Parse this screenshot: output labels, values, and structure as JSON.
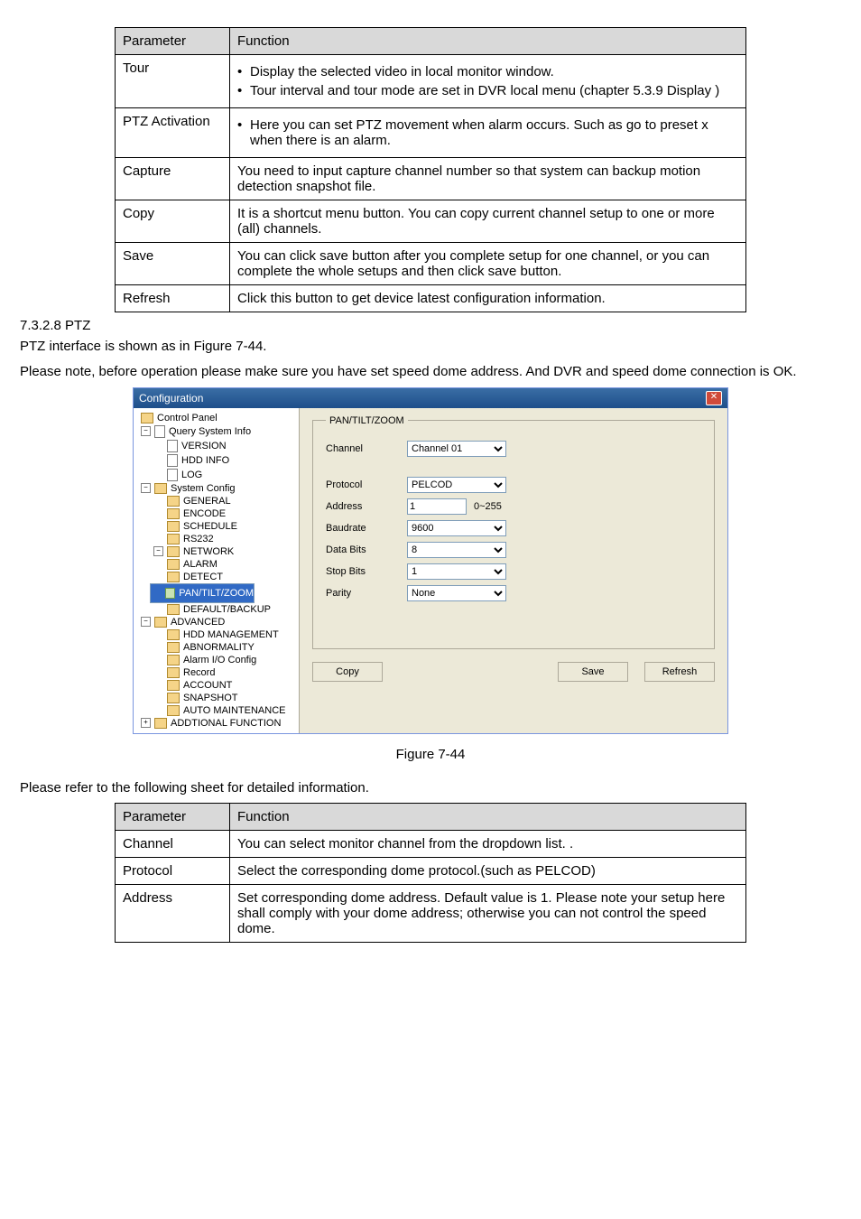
{
  "table1": {
    "headers": [
      "Parameter",
      "Function"
    ],
    "rows": [
      {
        "param": "Tour",
        "bullets": [
          "Display the selected video in local monitor window.",
          "Tour interval and tour mode are set in DVR local menu (chapter 5.3.9 Display )"
        ]
      },
      {
        "param": "PTZ Activation",
        "text": "Here you can set PTZ movement when alarm occurs. Such as go to preset x when there is an alarm.",
        "bullet": true
      },
      {
        "param": "Capture",
        "text": "You need to input capture channel number so that system can backup motion detection snapshot file."
      },
      {
        "param": "Copy",
        "text": "It is a shortcut menu button. You can copy current channel setup to one or more (all) channels."
      },
      {
        "param": "Save",
        "text": "You can click save button after you complete setup for one channel, or you can complete the whole setups and then click save button."
      },
      {
        "param": "Refresh",
        "text": "Click this button to get device latest configuration information."
      }
    ]
  },
  "section_num": "7.3.2.8  PTZ",
  "para1": "PTZ interface is shown as in Figure 7-44.",
  "para2": "Please note, before operation please make sure you have set speed dome address. And DVR and speed dome connection is OK.",
  "dialog": {
    "title": "Configuration",
    "legend": "PAN/TILT/ZOOM",
    "tree": [
      {
        "lvl": 1,
        "exp": "",
        "icon": "panel",
        "label": "Control Panel"
      },
      {
        "lvl": 1,
        "exp": "-",
        "icon": "doc",
        "label": "Query System Info"
      },
      {
        "lvl": 2,
        "exp": "",
        "icon": "doc",
        "label": "VERSION"
      },
      {
        "lvl": 2,
        "exp": "",
        "icon": "doc",
        "label": "HDD INFO"
      },
      {
        "lvl": 2,
        "exp": "",
        "icon": "doc",
        "label": "LOG"
      },
      {
        "lvl": 1,
        "exp": "-",
        "icon": "fld",
        "label": "System Config"
      },
      {
        "lvl": 2,
        "exp": "",
        "icon": "fld",
        "label": "GENERAL"
      },
      {
        "lvl": 2,
        "exp": "",
        "icon": "fld",
        "label": "ENCODE"
      },
      {
        "lvl": 2,
        "exp": "",
        "icon": "fld",
        "label": "SCHEDULE"
      },
      {
        "lvl": 2,
        "exp": "",
        "icon": "fld",
        "label": "RS232"
      },
      {
        "lvl": 2,
        "exp": "-",
        "icon": "fld",
        "label": "NETWORK"
      },
      {
        "lvl": 2,
        "exp": "",
        "icon": "fld",
        "label": "ALARM"
      },
      {
        "lvl": 2,
        "exp": "",
        "icon": "fld",
        "label": "DETECT"
      },
      {
        "lvl": 2,
        "exp": "",
        "icon": "open",
        "label": "PAN/TILT/ZOOM",
        "sel": true
      },
      {
        "lvl": 2,
        "exp": "",
        "icon": "fld",
        "label": "DEFAULT/BACKUP"
      },
      {
        "lvl": 1,
        "exp": "-",
        "icon": "adv",
        "label": "ADVANCED"
      },
      {
        "lvl": 2,
        "exp": "",
        "icon": "fld",
        "label": "HDD MANAGEMENT"
      },
      {
        "lvl": 2,
        "exp": "",
        "icon": "fld",
        "label": "ABNORMALITY"
      },
      {
        "lvl": 2,
        "exp": "",
        "icon": "fld",
        "label": "Alarm I/O Config"
      },
      {
        "lvl": 2,
        "exp": "",
        "icon": "fld",
        "label": "Record"
      },
      {
        "lvl": 2,
        "exp": "",
        "icon": "fld",
        "label": "ACCOUNT"
      },
      {
        "lvl": 2,
        "exp": "",
        "icon": "fld",
        "label": "SNAPSHOT"
      },
      {
        "lvl": 2,
        "exp": "",
        "icon": "fld",
        "label": "AUTO MAINTENANCE"
      },
      {
        "lvl": 1,
        "exp": "+",
        "icon": "fld",
        "label": "ADDTIONAL FUNCTION"
      }
    ],
    "fields": {
      "channel_lbl": "Channel",
      "channel_val": "Channel 01",
      "protocol_lbl": "Protocol",
      "protocol_val": "PELCOD",
      "address_lbl": "Address",
      "address_val": "1",
      "address_hint": "0~255",
      "baudrate_lbl": "Baudrate",
      "baudrate_val": "9600",
      "databits_lbl": "Data Bits",
      "databits_val": "8",
      "stopbits_lbl": "Stop Bits",
      "stopbits_val": "1",
      "parity_lbl": "Parity",
      "parity_val": "None"
    },
    "buttons": {
      "copy": "Copy",
      "save": "Save",
      "refresh": "Refresh"
    }
  },
  "figure_caption": "Figure 7-44",
  "para3": "Please refer to the following sheet for detailed information.",
  "table2": {
    "headers": [
      "Parameter",
      "Function"
    ],
    "rows": [
      {
        "param": "Channel",
        "text": "You can select monitor channel from the dropdown list. ."
      },
      {
        "param": "Protocol",
        "text": "Select the corresponding dome protocol.(such as PELCOD)"
      },
      {
        "param": "Address",
        "text": "Set corresponding dome address. Default value is 1. Please note your setup here shall comply with your dome address; otherwise you can not control the speed dome."
      }
    ]
  }
}
